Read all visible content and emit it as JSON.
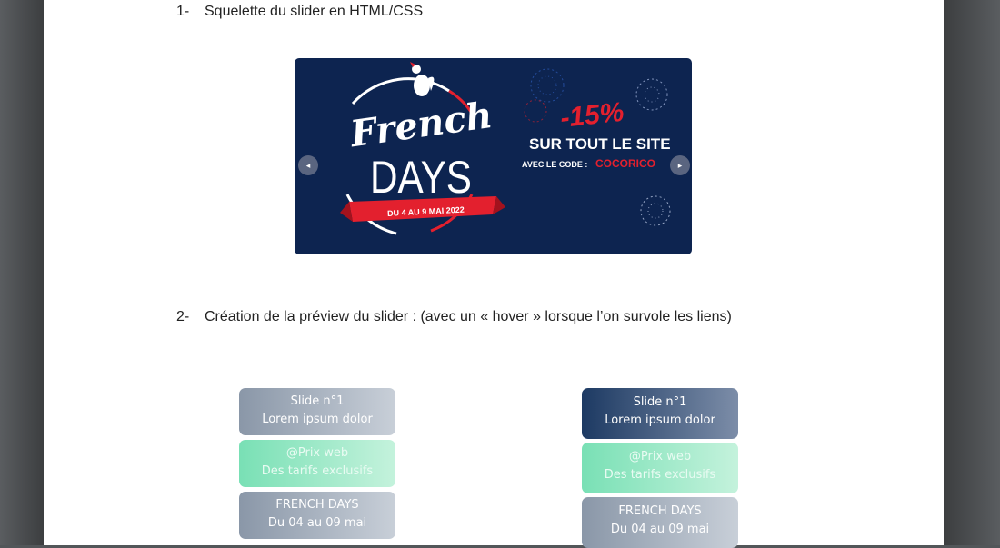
{
  "document": {
    "section1": {
      "number": "1-",
      "title": "Squelette du slider en HTML/CSS"
    },
    "section2": {
      "number": "2-",
      "title": "Création de la préview du slider : (avec un « hover » lorsque l’on survole les liens)"
    }
  },
  "banner": {
    "logo_line1": "French",
    "logo_line2": "DAYS",
    "ribbon": "DU 4 AU 9 MAI 2022",
    "discount": "-15%",
    "headline": "SUR TOUT LE SITE",
    "code_label": "AVEC LE CODE :",
    "code": "COCORICO",
    "prev_icon": "◂",
    "next_icon": "▸",
    "colors": {
      "background": "#0d2450",
      "red": "#e3202e",
      "white": "#ffffff"
    }
  },
  "preview_normal": [
    {
      "line1": "Slide n°1",
      "line2": "Lorem ipsum dolor"
    },
    {
      "line1": "@Prix web",
      "line2": "Des tarifs exclusifs"
    },
    {
      "line1": "FRENCH DAYS",
      "line2": "Du 04 au 09 mai"
    }
  ],
  "preview_hover": [
    {
      "line1": "Slide n°1",
      "line2": "Lorem ipsum dolor"
    },
    {
      "line1": "@Prix web",
      "line2": "Des tarifs exclusifs"
    },
    {
      "line1": "FRENCH DAYS",
      "line2": "Du 04 au 09 mai"
    }
  ]
}
